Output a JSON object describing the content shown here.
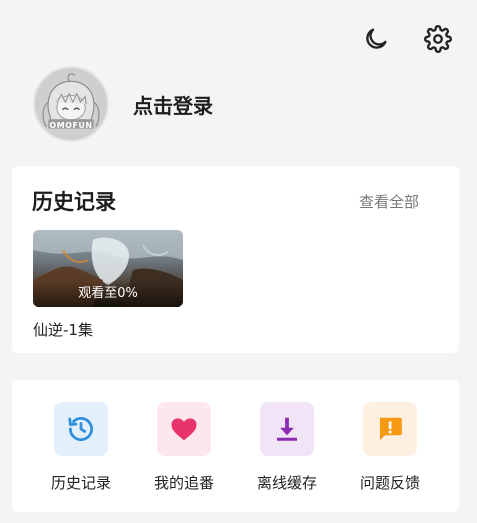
{
  "topbar": {
    "icons": [
      "moon-icon",
      "gear-icon"
    ]
  },
  "profile": {
    "avatar_brand": "OMOFUN",
    "login_label": "点击登录"
  },
  "history": {
    "title": "历史记录",
    "view_all_label": "查看全部",
    "items": [
      {
        "progress_label": "观看至0%",
        "progress_fraction": 0.0,
        "title": "仙逆-1集"
      }
    ]
  },
  "actions": [
    {
      "label": "历史记录",
      "icon": "history-icon",
      "color": "#2f8fdc",
      "bg": "#e3f0fb"
    },
    {
      "label": "我的追番",
      "icon": "heart-icon",
      "color": "#e8336b",
      "bg": "#fde6ee"
    },
    {
      "label": "离线缓存",
      "icon": "download-icon",
      "color": "#8b2db0",
      "bg": "#f1e4f6"
    },
    {
      "label": "问题反馈",
      "icon": "feedback-icon",
      "color": "#f59a12",
      "bg": "#fdf0e0"
    }
  ]
}
